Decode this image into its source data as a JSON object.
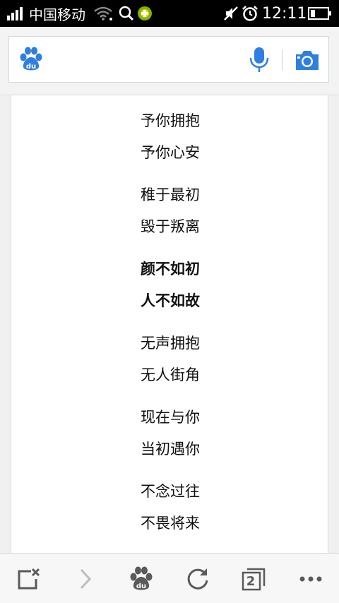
{
  "status_bar": {
    "carrier": "中国移动",
    "time": "12:11",
    "icons": [
      "signal-icon",
      "wifi-icon",
      "search-notif-icon",
      "app-notif-icon",
      "mute-icon",
      "alarm-icon",
      "battery-icon"
    ]
  },
  "search": {
    "logo_text": "du",
    "value": "",
    "placeholder": ""
  },
  "poem": {
    "lines": [
      "予你拥抱",
      "予你心安",
      "稚于最初",
      "毁于叛离",
      "颜不如初",
      "人不如故",
      "无声拥抱",
      "无人街角",
      "现在与你",
      "当初遇你",
      "不念过往",
      "不畏将来"
    ],
    "bold_lines": [
      "颜不如初",
      "人不如故"
    ]
  },
  "toolbar": {
    "items": [
      "close-page-icon",
      "forward-icon",
      "baidu-home-icon",
      "refresh-icon",
      "windows-icon",
      "menu-icon"
    ],
    "home_logo_text": "du",
    "tab_count": "2"
  },
  "colors": {
    "accent_blue": "#2f7fe0",
    "icon_gray": "#5a5a5a",
    "disabled_gray": "#bdbdbd"
  }
}
